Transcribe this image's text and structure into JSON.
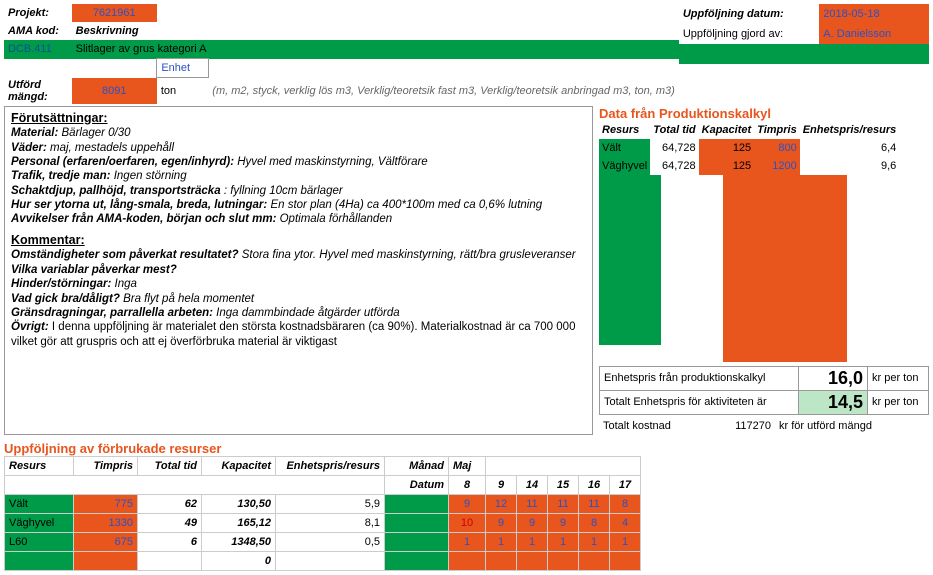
{
  "colors": {
    "orange": "#e8551d",
    "green": "#009b48",
    "lightGreen": "#bde6c7",
    "blue": "#2a52c7"
  },
  "header": {
    "projekt_label": "Projekt:",
    "projekt": "7621961",
    "ama_label": "AMA kod:",
    "ama": "Beskrivning",
    "code": "DCB.411",
    "desc": "Slitlager av grus kategori A",
    "enhet_label": "Enhet",
    "utford_label": "Utförd mängd:",
    "utford_val": "8091",
    "utford_unit": "ton",
    "utford_note": "(m, m2, styck, verklig lös m3, Verklig/teoretsik fast m3, Verklig/teoretsik anbringad m3, ton, m3)",
    "up_date_label": "Uppföljning datum:",
    "up_date": "2018-05-18",
    "up_by_label": "Uppföljning gjord av:",
    "up_by": "A. Danielsson"
  },
  "notes": {
    "section1_title": "Förutsättningar:",
    "material_l": "Material:",
    "material": "Bärlager 0/30",
    "vader_l": "Väder:",
    "vader": "maj, mestadels uppehåll",
    "personal_l": "Personal (erfaren/oerfaren, egen/inhyrd):",
    "personal": "Hyvel med maskinstyrning, Vältförare",
    "trafik_l": "Trafik, tredje man:",
    "trafik": "Ingen störning",
    "schakt_l": "Schaktdjup, pallhöjd, transportsträcka",
    "schakt": ": fyllning 10cm bärlager",
    "ytor_l": "Hur ser ytorna ut, lång-smala, breda, lutningar:",
    "ytor": "En stor plan (4Ha) ca 400*100m med ca 0,6% lutning",
    "avvik_l": "Avvikelser från AMA-koden, början och slut mm:",
    "avvik": "Optimala förhållanden",
    "section2_title": "Kommentar:",
    "q1_l": "Omständigheter som påverkat resultatet?",
    "q1": "Stora fina ytor. Hyvel med maskinstyrning, rätt/bra grusleveranser",
    "q2_l": "Vilka variablar påverkar mest?",
    "q3_l": "Hinder/störningar:",
    "q3": "Inga",
    "q4_l": "Vad gick bra/dåligt?",
    "q4": "Bra flyt på hela momentet",
    "q5_l": "Gränsdragningar, parrallella arbeten:",
    "q5": "Inga dammbindade åtgärder utförda",
    "q6_l": "Övrigt:",
    "q6": "I denna uppföljning är materialet den största kostnadsbäraren (ca 90%). Materialkostnad är ca 700 000 vilket gör att gruspris och att ej överförbruka material är viktigast"
  },
  "pk": {
    "title": "Data från Produktionskalkyl",
    "cols": [
      "Resurs",
      "Total tid",
      "Kapacitet",
      "Timpris",
      "Enhetspris/resurs"
    ],
    "rows": [
      {
        "name": "Vält",
        "tid": "64,728",
        "kap": "125",
        "pris": "800",
        "ep": "6,4"
      },
      {
        "name": "Väghyvel",
        "tid": "64,728",
        "kap": "125",
        "pris": "1200",
        "ep": "9,6"
      }
    ],
    "calc1_l": "Enhetspris från produktionskalkyl",
    "calc1_v": "16,0",
    "calc2_l": "Totalt Enhetspris för aktiviteten är",
    "calc2_v": "14,5",
    "unit": "kr per ton",
    "calc3_l": "Totalt kostnad",
    "calc3_v": "117270",
    "calc3_u": "kr för utförd mängd"
  },
  "res": {
    "title": "Uppföljning av förbrukade resurser",
    "month_l": "Månad",
    "month": "Maj",
    "date_l": "Datum",
    "days": [
      "8",
      "9",
      "14",
      "15",
      "16",
      "17"
    ],
    "cols": [
      "Resurs",
      "Timpris",
      "Total tid",
      "Kapacitet",
      "Enhetspris/resurs"
    ],
    "rows": [
      {
        "name": "Vält",
        "pris": "775",
        "tid": "62",
        "kap": "130,50",
        "ep": "5,9",
        "d": [
          "9",
          "12",
          "11",
          "11",
          "11",
          "8"
        ]
      },
      {
        "name": "Väghyvel",
        "pris": "1330",
        "tid": "49",
        "kap": "165,12",
        "ep": "8,1",
        "d": [
          "10",
          "9",
          "9",
          "9",
          "8",
          "4"
        ]
      },
      {
        "name": "L60",
        "pris": "675",
        "tid": "6",
        "kap": "1348,50",
        "ep": "0,5",
        "d": [
          "1",
          "1",
          "1",
          "1",
          "1",
          "1"
        ]
      },
      {
        "name": "",
        "pris": "",
        "tid": "",
        "kap": "0",
        "ep": "",
        "d": [
          "",
          "",
          "",
          "",
          "",
          ""
        ]
      }
    ]
  }
}
